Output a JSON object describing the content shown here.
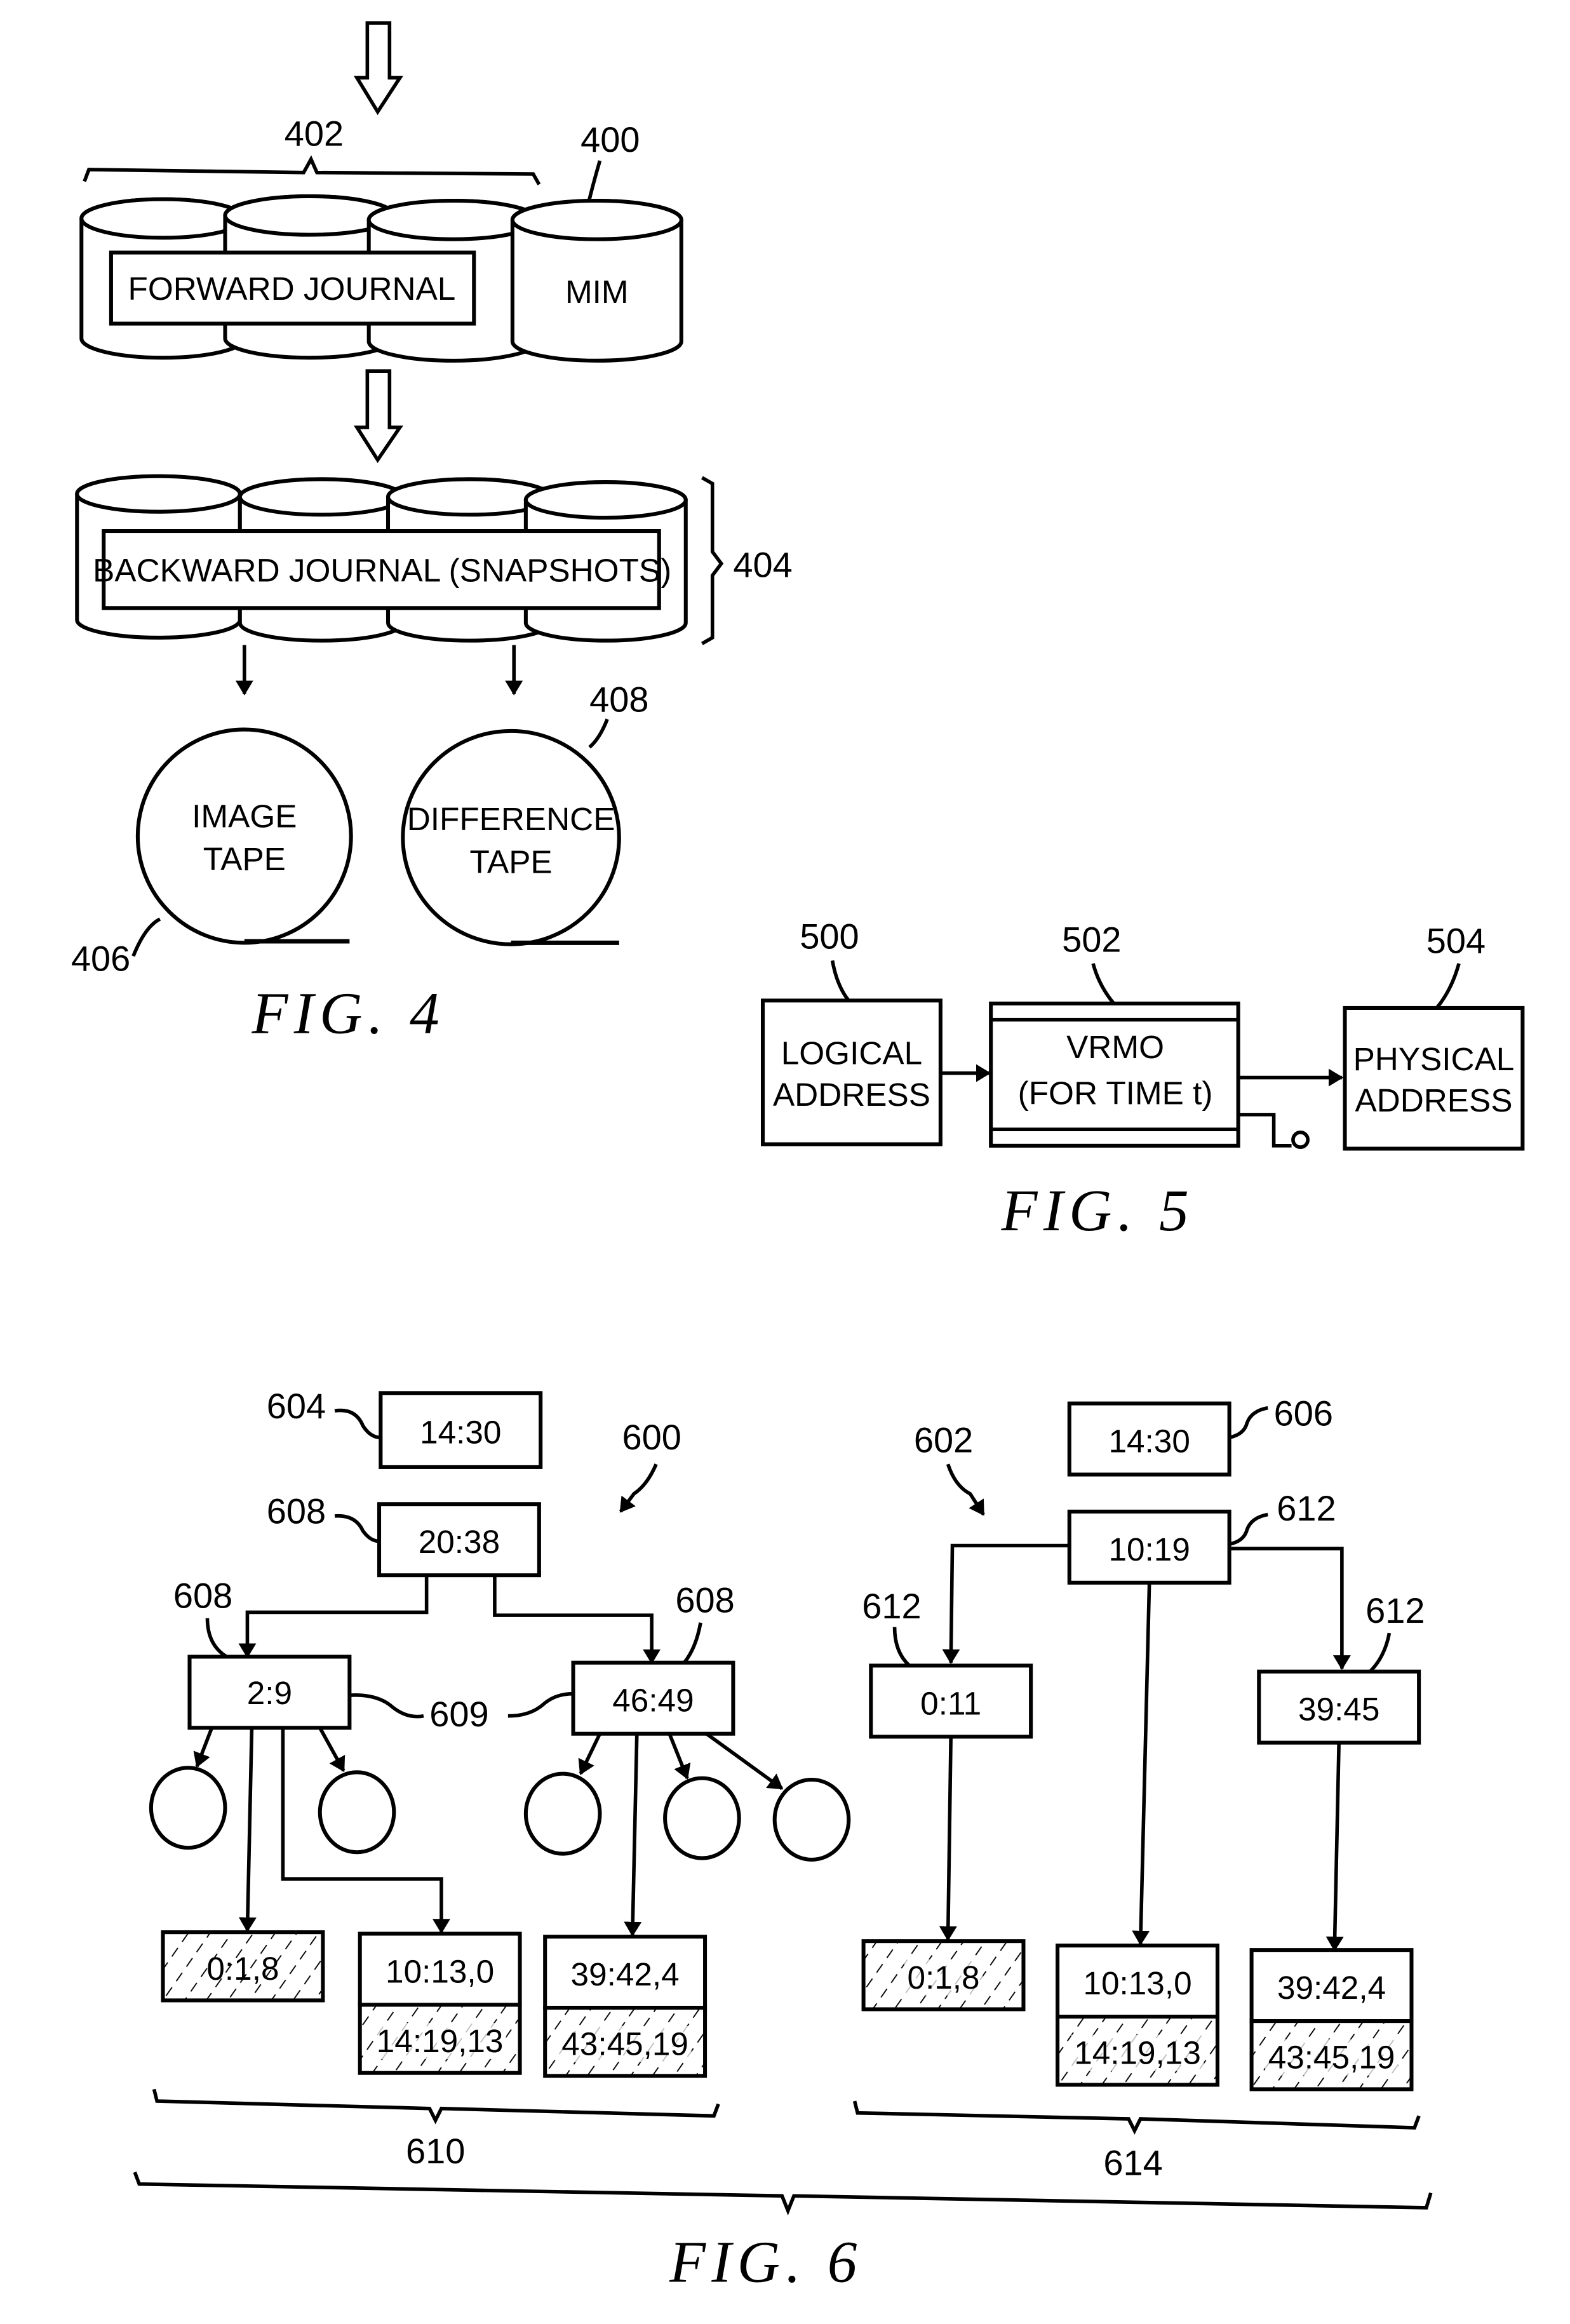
{
  "sheet": {
    "figures": [
      {
        "id": "fig4",
        "caption": "FIG. 4",
        "labels": {
          "forward_group": "402",
          "mim": "400",
          "backward_group": "404",
          "image_tape": "406",
          "difference_tape": "408"
        },
        "forward_journal": "FORWARD JOURNAL",
        "mim_label": "MIM",
        "backward_journal": "BACKWARD JOURNAL (SNAPSHOTS)",
        "image_tape": [
          "IMAGE",
          "TAPE"
        ],
        "difference_tape": [
          "DIFFERENCE",
          "TAPE"
        ]
      },
      {
        "id": "fig5",
        "caption": "FIG. 5",
        "labels": {
          "logical": "500",
          "vrmo": "502",
          "physical": "504"
        },
        "logical_address": [
          "LOGICAL",
          "ADDRESS"
        ],
        "vrmo": [
          "VRMO",
          "(FOR TIME t)"
        ],
        "physical_address": [
          "PHYSICAL",
          "ADDRESS"
        ]
      },
      {
        "id": "fig6",
        "caption": "FIG. 6",
        "left_tree": {
          "ref": "600",
          "time_box": {
            "label": "604",
            "value": "14:30"
          },
          "root": {
            "label": "608",
            "value": "20:38"
          },
          "children": [
            {
              "label": "608",
              "value": "2:9"
            },
            {
              "label": "608",
              "value": "46:49"
            }
          ],
          "link_label": "609",
          "leaves": [
            {
              "top": "0:1,8",
              "top_hatched": true,
              "bottom": null
            },
            {
              "top": "10:13,0",
              "top_hatched": false,
              "bottom": "14:19,13"
            },
            {
              "top": "39:42,4",
              "top_hatched": false,
              "bottom": "43:45,19"
            }
          ],
          "group_label": "610"
        },
        "right_tree": {
          "ref": "602",
          "time_box": {
            "label": "606",
            "value": "14:30"
          },
          "root": {
            "label": "612",
            "value": "10:19"
          },
          "children": [
            {
              "label": "612",
              "value": "0:11"
            },
            {
              "label": "612",
              "value": "39:45"
            }
          ],
          "leaves": [
            {
              "top": "0:1,8",
              "top_hatched": true,
              "bottom": null
            },
            {
              "top": "10:13,0",
              "top_hatched": false,
              "bottom": "14:19,13"
            },
            {
              "top": "39:42,4",
              "top_hatched": false,
              "bottom": "43:45,19"
            }
          ],
          "group_label": "614"
        }
      }
    ]
  }
}
